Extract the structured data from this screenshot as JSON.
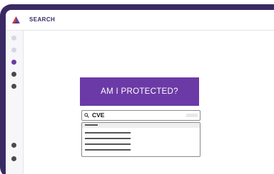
{
  "header": {
    "title": "SEARCH",
    "logo_icon": "brand-logo-icon",
    "brand_colors": [
      "#d33b34",
      "#6c3aa6",
      "#3a2a63"
    ]
  },
  "sidebar": {
    "items": [
      {
        "icon": "nav-dot-icon",
        "state": "inactive",
        "color": "#d7d5e6"
      },
      {
        "icon": "nav-dot-icon",
        "state": "inactive",
        "color": "#d7d5e6"
      },
      {
        "icon": "nav-dot-icon",
        "state": "active",
        "color": "#6c3aa6"
      },
      {
        "icon": "nav-dot-icon",
        "state": "default",
        "color": "#4a4a4a"
      },
      {
        "icon": "nav-dot-icon",
        "state": "default",
        "color": "#4a4a4a"
      },
      {
        "icon": "nav-dot-icon",
        "state": "default",
        "color": "#4a4a4a"
      },
      {
        "icon": "nav-dot-icon",
        "state": "default",
        "color": "#4a4a4a"
      }
    ]
  },
  "main": {
    "primary_button_label": "AM I PROTECTED?",
    "search": {
      "value": "CVE",
      "icon": "search-icon"
    },
    "results": {
      "row_count": 4
    }
  },
  "colors": {
    "accent": "#6c3aa6",
    "frame": "#3a2a63"
  }
}
